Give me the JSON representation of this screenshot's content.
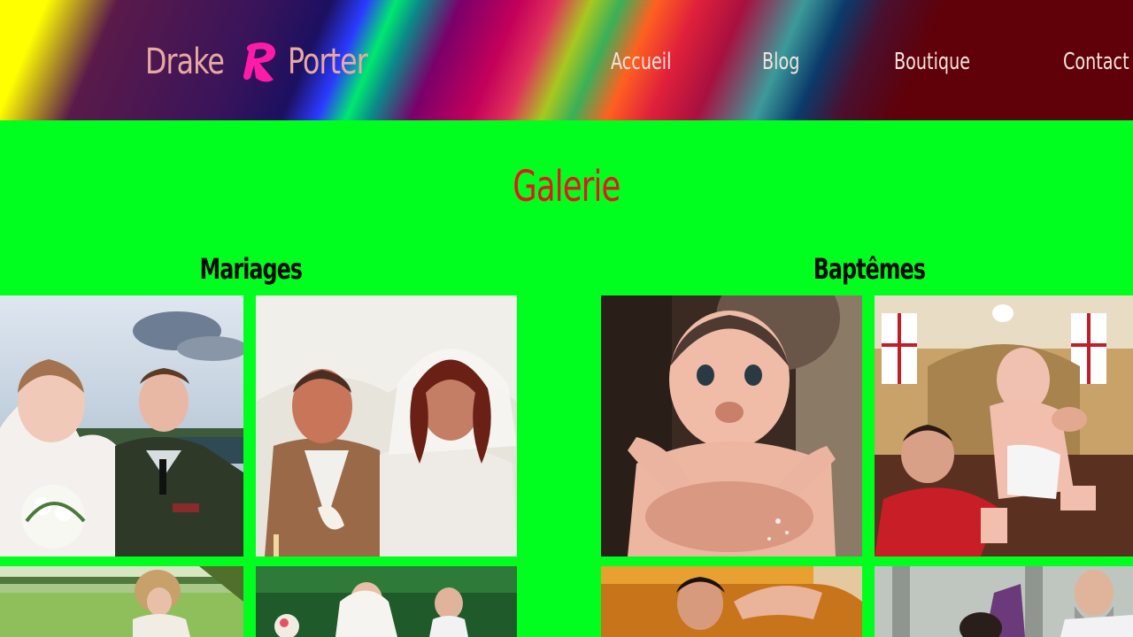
{
  "header": {
    "logo_left": "Drake",
    "logo_right": "Porter",
    "logo_mark": "logo-r-mark-icon",
    "nav": [
      {
        "label": "Accueil"
      },
      {
        "label": "Blog"
      },
      {
        "label": "Boutique"
      },
      {
        "label": "Contact"
      }
    ]
  },
  "main": {
    "title": "Galerie",
    "sections": [
      {
        "title": "Mariages"
      },
      {
        "title": "Baptêmes"
      }
    ]
  },
  "colors": {
    "page_background": "#00ff1e",
    "title_color": "#e8141e",
    "nav_text": "#f2e4dc",
    "logo_text": "#e8a9a0",
    "logo_mark": "#ff1aa8"
  }
}
